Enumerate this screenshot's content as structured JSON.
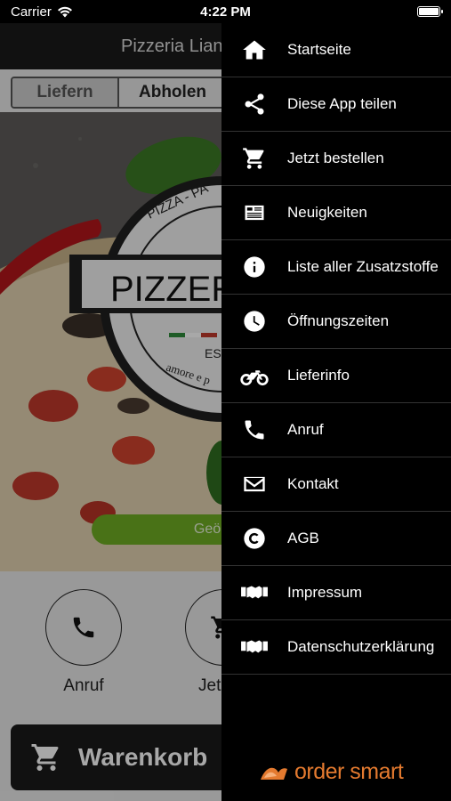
{
  "status": {
    "carrier": "Carrier",
    "time": "4:22 PM",
    "battery_level": 1.0
  },
  "app": {
    "title": "Pizzeria Liand",
    "tabs": [
      {
        "label": "Liefern",
        "active": true
      },
      {
        "label": "Abholen",
        "active": false
      }
    ],
    "logo_text": "PIZZER",
    "logo_sub_1": "PIZZA - PA",
    "logo_sub_2": "EST",
    "logo_sub_3": "amore e p",
    "order_button": "Geö",
    "actions": [
      {
        "label": "Anruf",
        "icon": "phone-icon"
      },
      {
        "label": "Jetzt b",
        "icon": "cart-icon"
      }
    ],
    "cart_label": "Warenkorb"
  },
  "menu": {
    "items": [
      {
        "label": "Startseite",
        "icon": "home-icon"
      },
      {
        "label": "Diese App teilen",
        "icon": "share-icon"
      },
      {
        "label": "Jetzt bestellen",
        "icon": "cart-icon"
      },
      {
        "label": "Neuigkeiten",
        "icon": "news-icon"
      },
      {
        "label": "Liste aller Zusatzstoffe",
        "icon": "info-icon"
      },
      {
        "label": "Öffnungszeiten",
        "icon": "clock-icon"
      },
      {
        "label": "Lieferinfo",
        "icon": "motorcycle-icon"
      },
      {
        "label": "Anruf",
        "icon": "phone-icon"
      },
      {
        "label": "Kontakt",
        "icon": "envelope-icon"
      },
      {
        "label": "AGB",
        "icon": "copyright-icon"
      },
      {
        "label": "Impressum",
        "icon": "handshake-icon"
      },
      {
        "label": "Datenschutzerklärung",
        "icon": "handshake-icon"
      }
    ],
    "brand": "order smart",
    "brand_color": "#e47a2f"
  },
  "colors": {
    "accent_green": "#6fae23",
    "drawer_bg": "#000000"
  }
}
